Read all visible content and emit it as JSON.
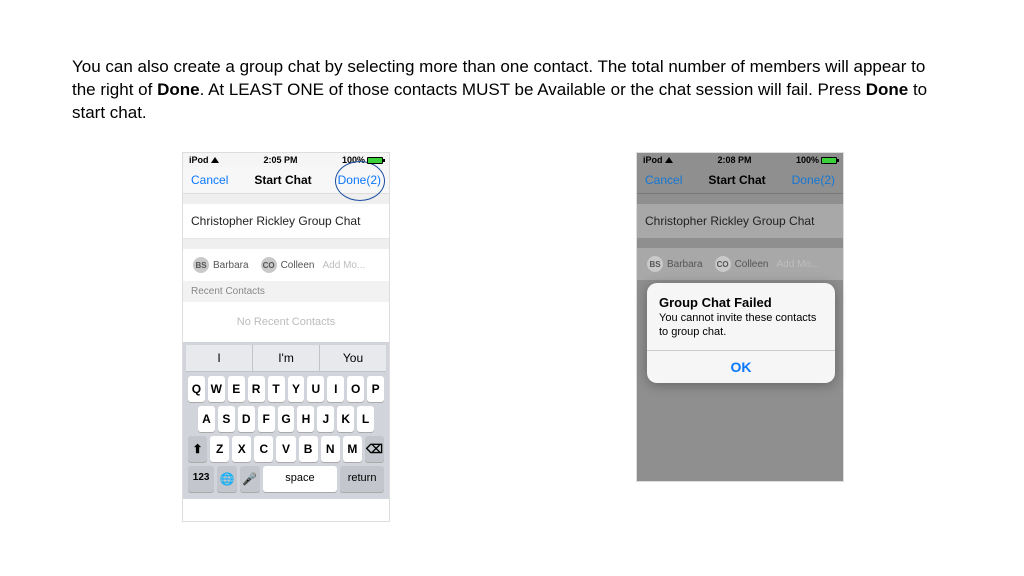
{
  "instruction": {
    "part1": "You can also create a group chat by selecting more than one contact.  The total number of members will appear to the right of ",
    "bold1": "Done",
    "part2": ".  At LEAST ONE of those contacts MUST be Available or the chat session will fail.  Press ",
    "bold2": "Done",
    "part3": " to start chat."
  },
  "phone1": {
    "device": "iPod",
    "time": "2:05 PM",
    "battery": "100%",
    "cancel": "Cancel",
    "title": "Start Chat",
    "done": "Done(2)",
    "group_title": "Christopher Rickley Group Chat",
    "chip1_initials": "BS",
    "chip1_name": "Barbara",
    "chip2_initials": "CO",
    "chip2_name": "Colleen",
    "add_more": "Add Mo...",
    "recent_header": "Recent Contacts",
    "no_recent": "No Recent Contacts",
    "suggest": {
      "a": "I",
      "b": "I'm",
      "c": "You"
    },
    "row1": [
      "Q",
      "W",
      "E",
      "R",
      "T",
      "Y",
      "U",
      "I",
      "O",
      "P"
    ],
    "row2": [
      "A",
      "S",
      "D",
      "F",
      "G",
      "H",
      "J",
      "K",
      "L"
    ],
    "row3": [
      "Z",
      "X",
      "C",
      "V",
      "B",
      "N",
      "M"
    ],
    "key_123": "123",
    "key_space": "space",
    "key_return": "return"
  },
  "phone2": {
    "device": "iPod",
    "time": "2:08 PM",
    "battery": "100%",
    "cancel": "Cancel",
    "title": "Start Chat",
    "done": "Done(2)",
    "group_title": "Christopher Rickley Group Chat",
    "chip1_initials": "BS",
    "chip1_name": "Barbara",
    "chip2_initials": "CO",
    "chip2_name": "Colleen",
    "add_more": "Add Mo...",
    "alert_title": "Group Chat Failed",
    "alert_body": "You cannot invite these contacts to group chat.",
    "alert_ok": "OK"
  }
}
